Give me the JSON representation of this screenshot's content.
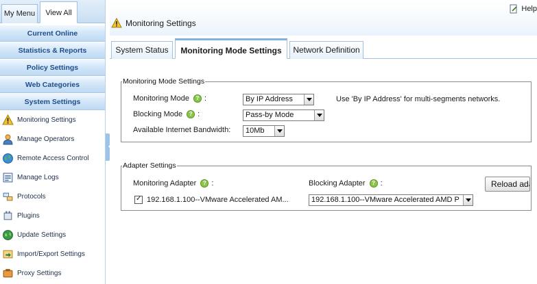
{
  "sidebar": {
    "tabs": [
      {
        "label": "My Menu"
      },
      {
        "label": "View All"
      }
    ],
    "categories": [
      {
        "label": "Current Online"
      },
      {
        "label": "Statistics & Reports"
      },
      {
        "label": "Policy Settings"
      },
      {
        "label": "Web Categories"
      },
      {
        "label": "System Settings"
      }
    ],
    "items": [
      {
        "label": "Monitoring Settings",
        "icon": "warning-icon"
      },
      {
        "label": "Manage Operators",
        "icon": "user-icon"
      },
      {
        "label": "Remote Access Control",
        "icon": "globe-icon"
      },
      {
        "label": "Manage Logs",
        "icon": "logs-icon"
      },
      {
        "label": "Protocols",
        "icon": "protocol-icon"
      },
      {
        "label": "Plugins",
        "icon": "plugin-icon"
      },
      {
        "label": "Update Settings",
        "icon": "update-globe-icon"
      },
      {
        "label": "Import/Export Settings",
        "icon": "import-export-icon"
      },
      {
        "label": "Proxy Settings",
        "icon": "proxy-icon"
      }
    ]
  },
  "header": {
    "title": "Monitoring Settings",
    "help_label": "Help"
  },
  "tabs": [
    {
      "label": "System Status"
    },
    {
      "label": "Monitoring Mode Settings"
    },
    {
      "label": "Network Definition"
    }
  ],
  "monitoring_mode_settings": {
    "legend": "Monitoring Mode Settings",
    "monitoring_mode": {
      "label": "Monitoring Mode",
      "value": "By IP Address",
      "hint": "Use 'By IP Address' for multi-segments networks."
    },
    "blocking_mode": {
      "label": "Blocking Mode",
      "value": "Pass-by Mode"
    },
    "bandwidth": {
      "label": "Available Internet Bandwidth:",
      "value": "10Mb"
    }
  },
  "adapter_settings": {
    "legend": "Adapter Settings",
    "monitoring_adapter": {
      "label": "Monitoring Adapter",
      "value": "192.168.1.100--VMware Accelerated AM..."
    },
    "blocking_adapter": {
      "label": "Blocking Adapter",
      "value": "192.168.1.100--VMware Accelerated AMD P"
    },
    "reload_button": "Reload ada"
  },
  "colors": {
    "accent": "#1f4d89",
    "help_icon": "#8fc44c"
  }
}
